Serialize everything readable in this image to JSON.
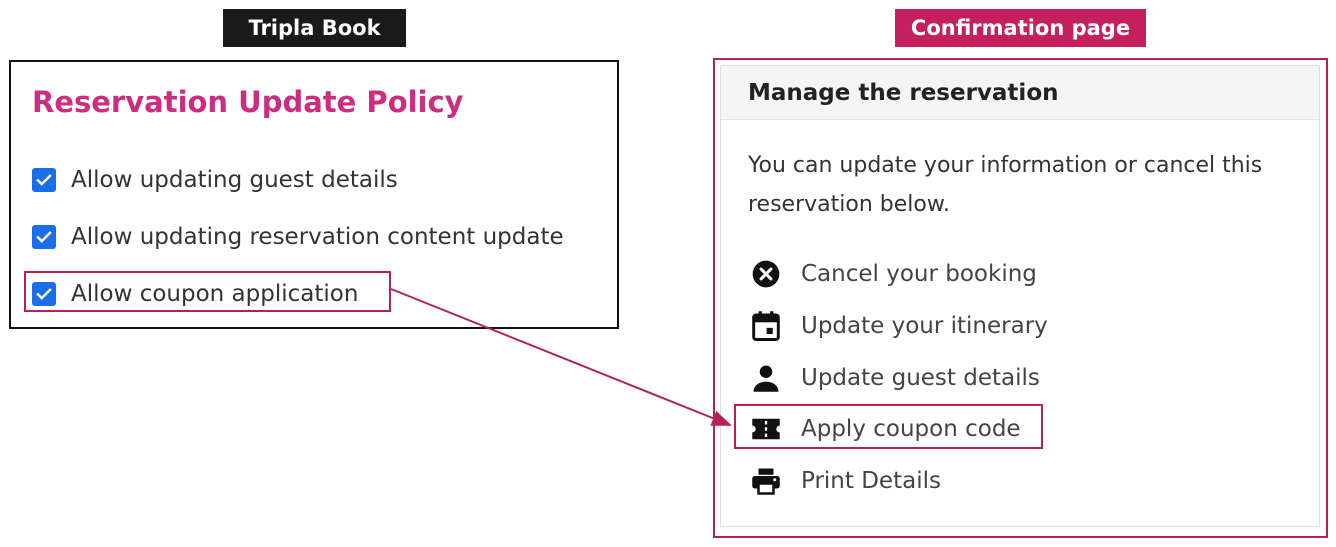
{
  "labels": {
    "left_tag": "Tripla Book",
    "right_tag": "Confirmation page"
  },
  "policy": {
    "title": "Reservation Update Policy",
    "options": [
      {
        "label": "Allow updating guest details",
        "checked": true
      },
      {
        "label": "Allow updating reservation content update",
        "checked": true
      },
      {
        "label": "Allow coupon application",
        "checked": true
      }
    ]
  },
  "manage": {
    "header": "Manage the reservation",
    "description": "You can update your information or cancel this reservation below.",
    "actions": [
      {
        "label": "Cancel your booking",
        "icon": "cancel-circle-icon"
      },
      {
        "label": "Update your itinerary",
        "icon": "calendar-icon"
      },
      {
        "label": "Update guest details",
        "icon": "person-icon"
      },
      {
        "label": "Apply coupon code",
        "icon": "ticket-icon"
      },
      {
        "label": "Print Details",
        "icon": "printer-icon"
      }
    ]
  },
  "colors": {
    "title_accent": "#cd2d7f",
    "highlight": "#b3205a",
    "checkbox": "#1a6fe8",
    "tag_dark": "#1a1a1a",
    "tag_accent": "#c4205e"
  }
}
